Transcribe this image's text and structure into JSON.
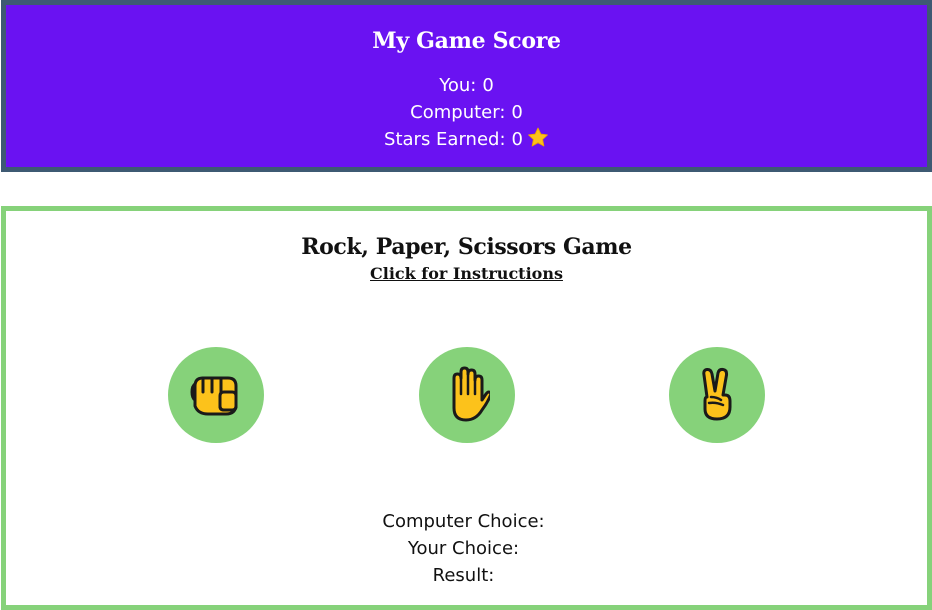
{
  "score": {
    "title": "My Game Score",
    "you_label": "You:",
    "you_value": "0",
    "computer_label": "Computer:",
    "computer_value": "0",
    "stars_label": "Stars Earned:",
    "stars_value": "0",
    "stars_icon": "star-icon"
  },
  "game": {
    "title": "Rock, Paper, Scissors Game",
    "instructions_link": "Click for Instructions",
    "choices": [
      {
        "name": "rock",
        "icon": "fist-icon"
      },
      {
        "name": "paper",
        "icon": "raised-hand-icon"
      },
      {
        "name": "scissors",
        "icon": "victory-hand-icon"
      }
    ]
  },
  "results": {
    "computer_choice_label": "Computer Choice:",
    "computer_choice_value": "",
    "your_choice_label": "Your Choice:",
    "your_choice_value": "",
    "result_label": "Result:",
    "result_value": ""
  },
  "colors": {
    "score_background": "#6a12f2",
    "score_border": "#3e5a73",
    "game_border": "#86d27a",
    "choice_button": "#86d27a",
    "hand_fill": "#fcc21b"
  }
}
